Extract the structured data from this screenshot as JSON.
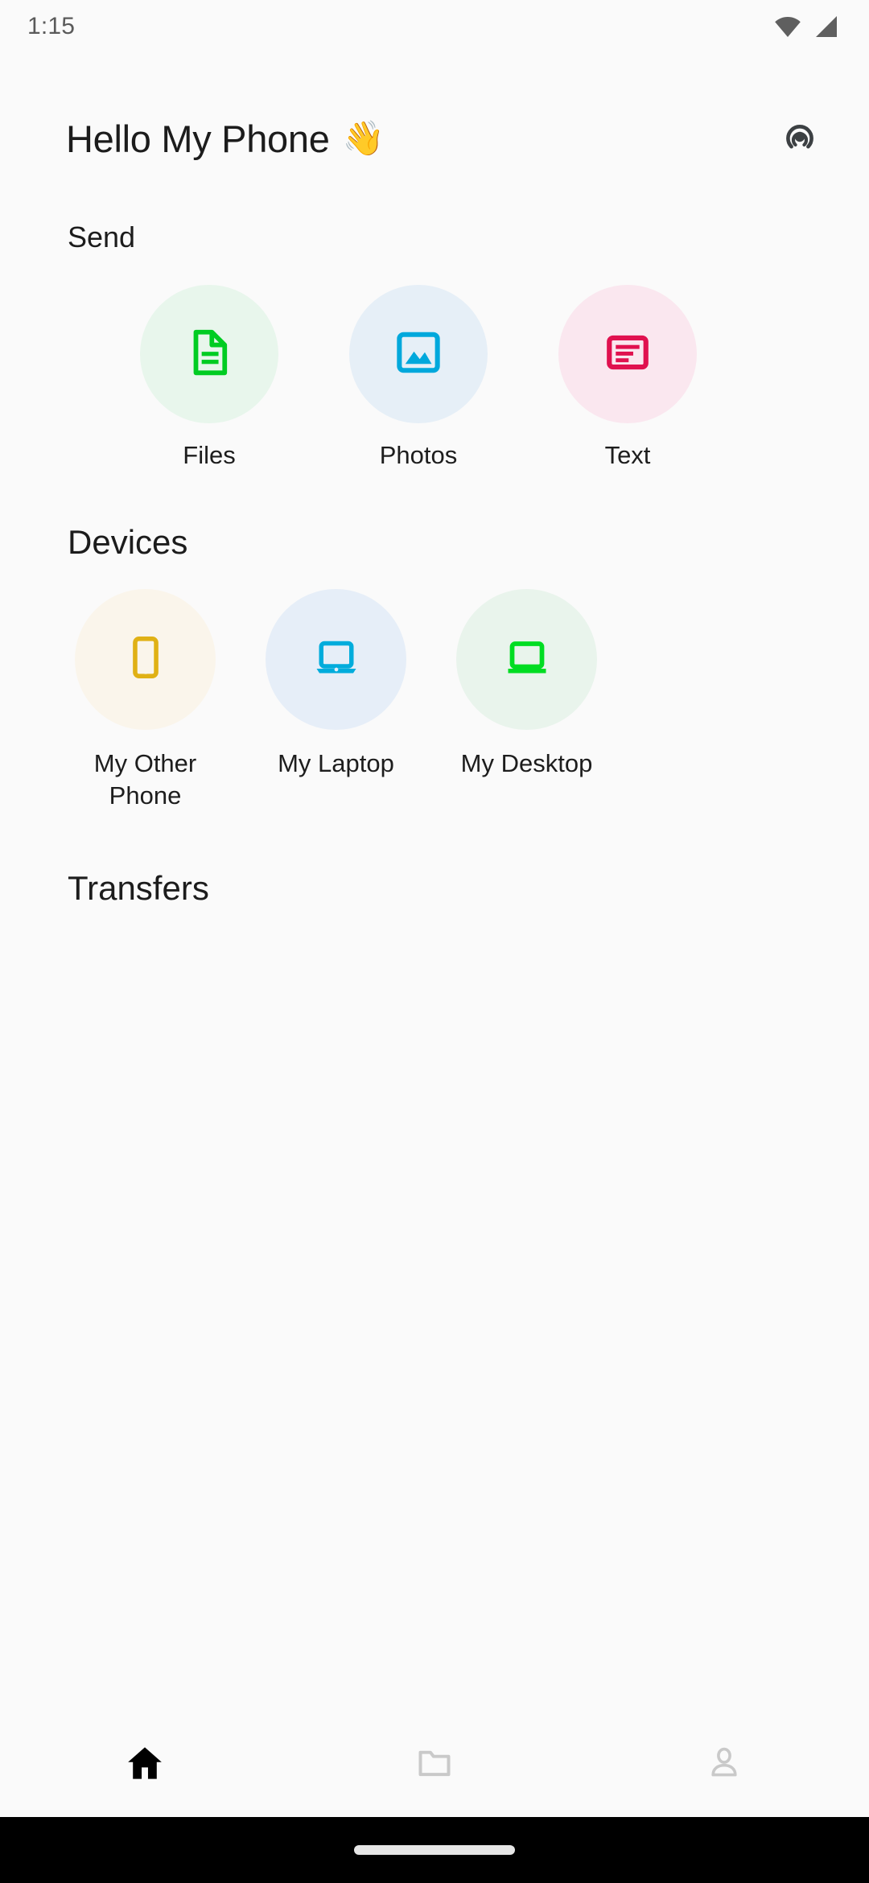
{
  "status_bar": {
    "time": "1:15",
    "wifi_icon": "wifi-icon",
    "signal_icon": "cellular-signal-icon",
    "icon_color": "#5F5F5F"
  },
  "app_bar": {
    "title": "Hello My Phone",
    "title_emoji": "👋",
    "action_icon": "broadcast-icon",
    "action_icon_color": "#3C4043"
  },
  "send_section": {
    "header": "Send",
    "items": [
      {
        "label": "Files",
        "icon": "document-icon",
        "icon_color": "#00CC22",
        "circle_color": "#E8F6EC"
      },
      {
        "label": "Photos",
        "icon": "image-icon",
        "icon_color": "#00A8DC",
        "circle_color": "#E6EFF7"
      },
      {
        "label": "Text",
        "icon": "text-lines-icon",
        "icon_color": "#E0114F",
        "circle_color": "#FAE7EF"
      }
    ]
  },
  "devices_section": {
    "header": "Devices",
    "items": [
      {
        "label": "My Other Phone",
        "icon": "smartphone-icon",
        "icon_color": "#E0B115",
        "circle_color": "#FAF5EB"
      },
      {
        "label": "My Laptop",
        "icon": "laptop-icon",
        "icon_color": "#00ACDC",
        "circle_color": "#E6EEF8"
      },
      {
        "label": "My Desktop",
        "icon": "monitor-icon",
        "icon_color": "#00DD22",
        "circle_color": "#E9F4EC"
      }
    ]
  },
  "transfers_section": {
    "header": "Transfers",
    "items": []
  },
  "bottom_nav": {
    "items": [
      {
        "name": "home",
        "icon": "home-icon",
        "active": true,
        "color": "#000000"
      },
      {
        "name": "files",
        "icon": "folder-icon",
        "active": false,
        "color": "#C9C9C9"
      },
      {
        "name": "profile",
        "icon": "person-icon",
        "active": false,
        "color": "#C9C9C9"
      }
    ]
  },
  "gesture_bar": {
    "indicator": "home-pill-indicator",
    "background": "#000000",
    "pill_color": "#E6E6E6"
  }
}
